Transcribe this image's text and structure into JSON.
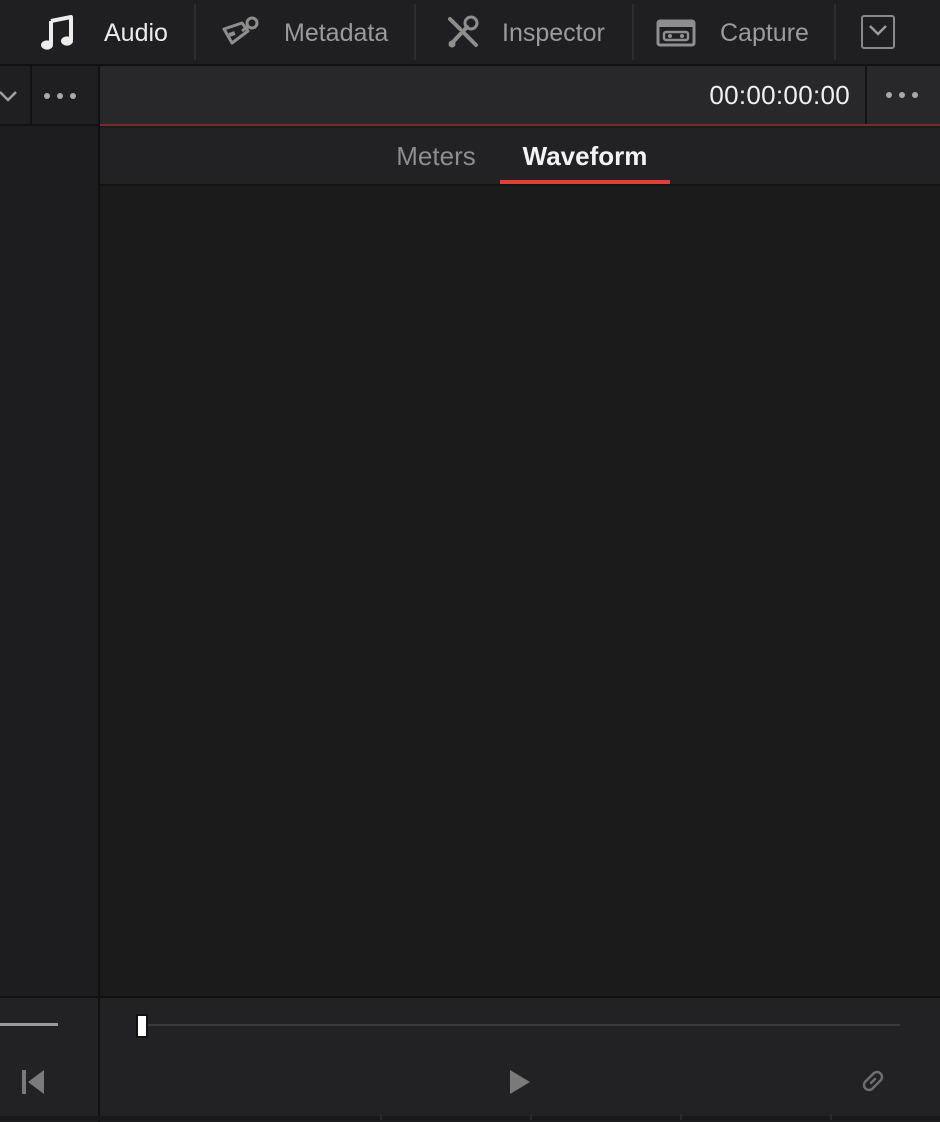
{
  "toolbar": {
    "items": [
      {
        "label": "Audio",
        "icon": "music-note-icon",
        "active": true
      },
      {
        "label": "Metadata",
        "icon": "tag-icon",
        "active": false
      },
      {
        "label": "Inspector",
        "icon": "tools-icon",
        "active": false
      },
      {
        "label": "Capture",
        "icon": "tape-deck-icon",
        "active": false
      }
    ],
    "expand_icon": "chevron-down-icon"
  },
  "viewer": {
    "timecode": "00:00:00:00",
    "tabs": [
      {
        "label": "Meters",
        "active": false
      },
      {
        "label": "Waveform",
        "active": true
      }
    ]
  },
  "transport": {
    "scrubber_position": 0.0,
    "icons": [
      "skip-to-start-icon",
      "play-icon",
      "link-icon"
    ]
  },
  "colors": {
    "accent": "#e0403a",
    "background": "#1b1b1c",
    "panel": "#222224",
    "text_active": "#ececec",
    "text_inactive": "#9b9b9b"
  }
}
